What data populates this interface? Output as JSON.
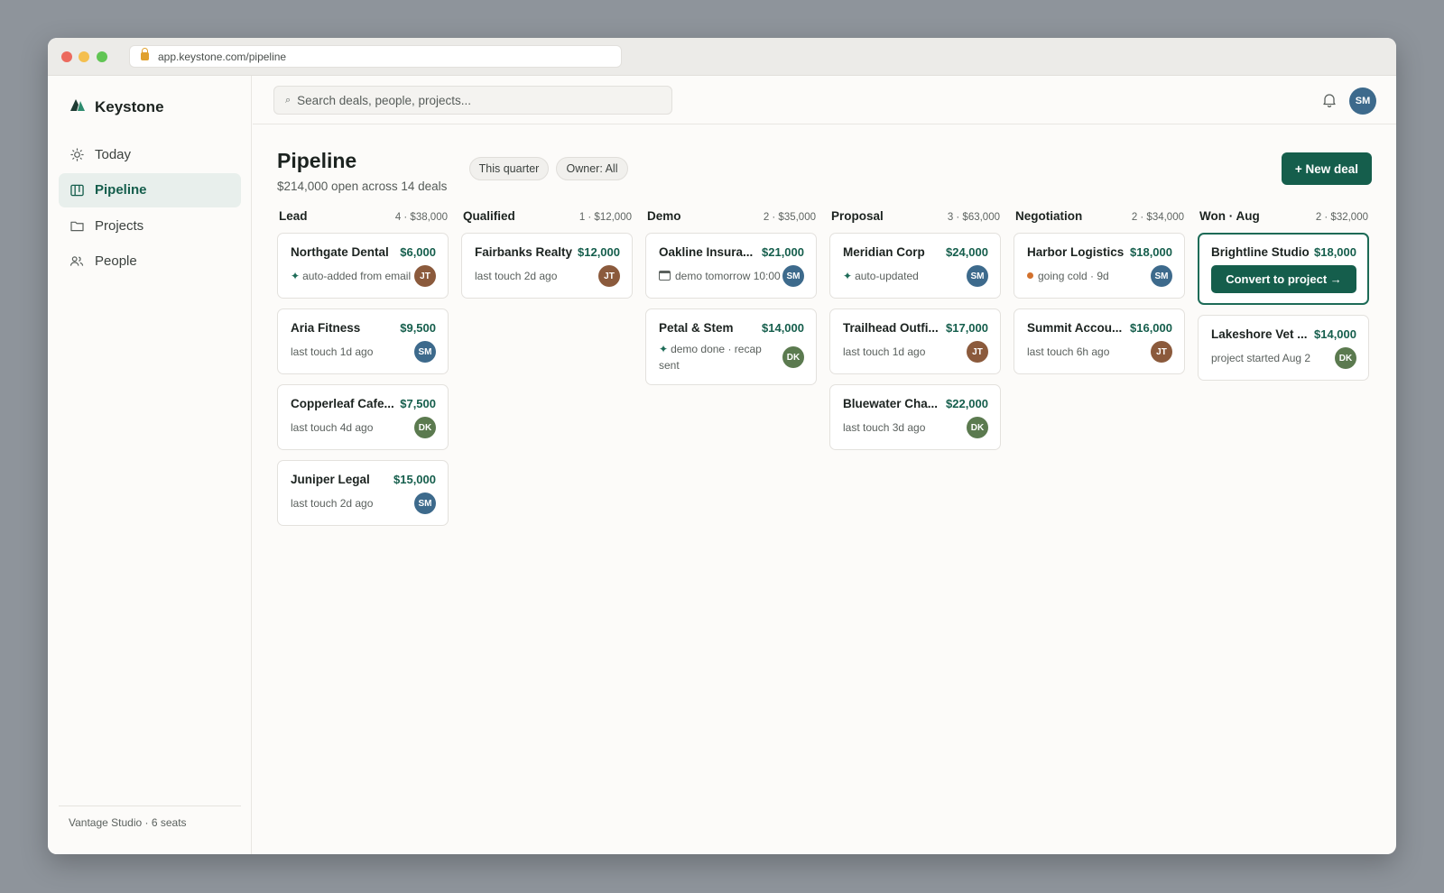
{
  "browser": {
    "url": "app.keystone.com/pipeline"
  },
  "brand": {
    "name": "Keystone"
  },
  "nav": [
    {
      "label": "Today",
      "icon": "sun-icon",
      "active": false
    },
    {
      "label": "Pipeline",
      "icon": "kanban-icon",
      "active": true
    },
    {
      "label": "Projects",
      "icon": "folder-icon",
      "active": false
    },
    {
      "label": "People",
      "icon": "people-icon",
      "active": false
    }
  ],
  "sidebar_footer": "Vantage Studio · 6 seats",
  "search": {
    "placeholder": "Search deals, people, projects..."
  },
  "user": {
    "initials": "SM"
  },
  "page": {
    "title": "Pipeline",
    "subtitle": "$214,000 open across 14 deals",
    "filters": {
      "quarter": "This quarter",
      "owner": "Owner: All"
    },
    "new_deal_label": "+ New deal"
  },
  "avatar_colors": {
    "JT": "#8b5a3c",
    "SM": "#3d6a8c",
    "DK": "#5b7a4f"
  },
  "columns": [
    {
      "name": "Lead",
      "meta": "4 · $38,000",
      "cards": [
        {
          "name": "Northgate Dental",
          "value": "$6,000",
          "note": "auto-added from email",
          "note_icon": "spark",
          "owner": "JT"
        },
        {
          "name": "Aria Fitness",
          "value": "$9,500",
          "note": "last touch 1d ago",
          "note_icon": "",
          "owner": "SM"
        },
        {
          "name": "Copperleaf Cafe...",
          "value": "$7,500",
          "note": "last touch 4d ago",
          "note_icon": "",
          "owner": "DK"
        },
        {
          "name": "Juniper Legal",
          "value": "$15,000",
          "note": "last touch 2d ago",
          "note_icon": "",
          "owner": "SM"
        }
      ]
    },
    {
      "name": "Qualified",
      "meta": "1 · $12,000",
      "cards": [
        {
          "name": "Fairbanks Realty",
          "value": "$12,000",
          "note": "last touch 2d ago",
          "note_icon": "",
          "owner": "JT"
        }
      ]
    },
    {
      "name": "Demo",
      "meta": "2 · $35,000",
      "cards": [
        {
          "name": "Oakline Insura...",
          "value": "$21,000",
          "note": "demo tomorrow 10:00",
          "note_icon": "calendar",
          "owner": "SM"
        },
        {
          "name": "Petal & Stem",
          "value": "$14,000",
          "note": "demo done · recap sent",
          "note_icon": "spark",
          "owner": "DK"
        }
      ]
    },
    {
      "name": "Proposal",
      "meta": "3 · $63,000",
      "cards": [
        {
          "name": "Meridian Corp",
          "value": "$24,000",
          "note": "auto-updated",
          "note_icon": "spark",
          "owner": "SM"
        },
        {
          "name": "Trailhead Outfi...",
          "value": "$17,000",
          "note": "last touch 1d ago",
          "note_icon": "",
          "owner": "JT"
        },
        {
          "name": "Bluewater Cha...",
          "value": "$22,000",
          "note": "last touch 3d ago",
          "note_icon": "",
          "owner": "DK"
        }
      ]
    },
    {
      "name": "Negotiation",
      "meta": "2 · $34,000",
      "cards": [
        {
          "name": "Harbor Logistics",
          "value": "$18,000",
          "note": "going cold · 9d",
          "note_icon": "cold",
          "owner": "SM"
        },
        {
          "name": "Summit Accou...",
          "value": "$16,000",
          "note": "last touch 6h ago",
          "note_icon": "",
          "owner": "JT"
        }
      ]
    },
    {
      "name": "Won · Aug",
      "meta": "2 · $32,000",
      "cards": [
        {
          "name": "Brightline Studio",
          "value": "$18,000",
          "highlight": true,
          "action": "Convert to project →"
        },
        {
          "name": "Lakeshore Vet ...",
          "value": "$14,000",
          "note": "project started Aug 2",
          "note_icon": "",
          "owner": "DK"
        }
      ]
    }
  ]
}
